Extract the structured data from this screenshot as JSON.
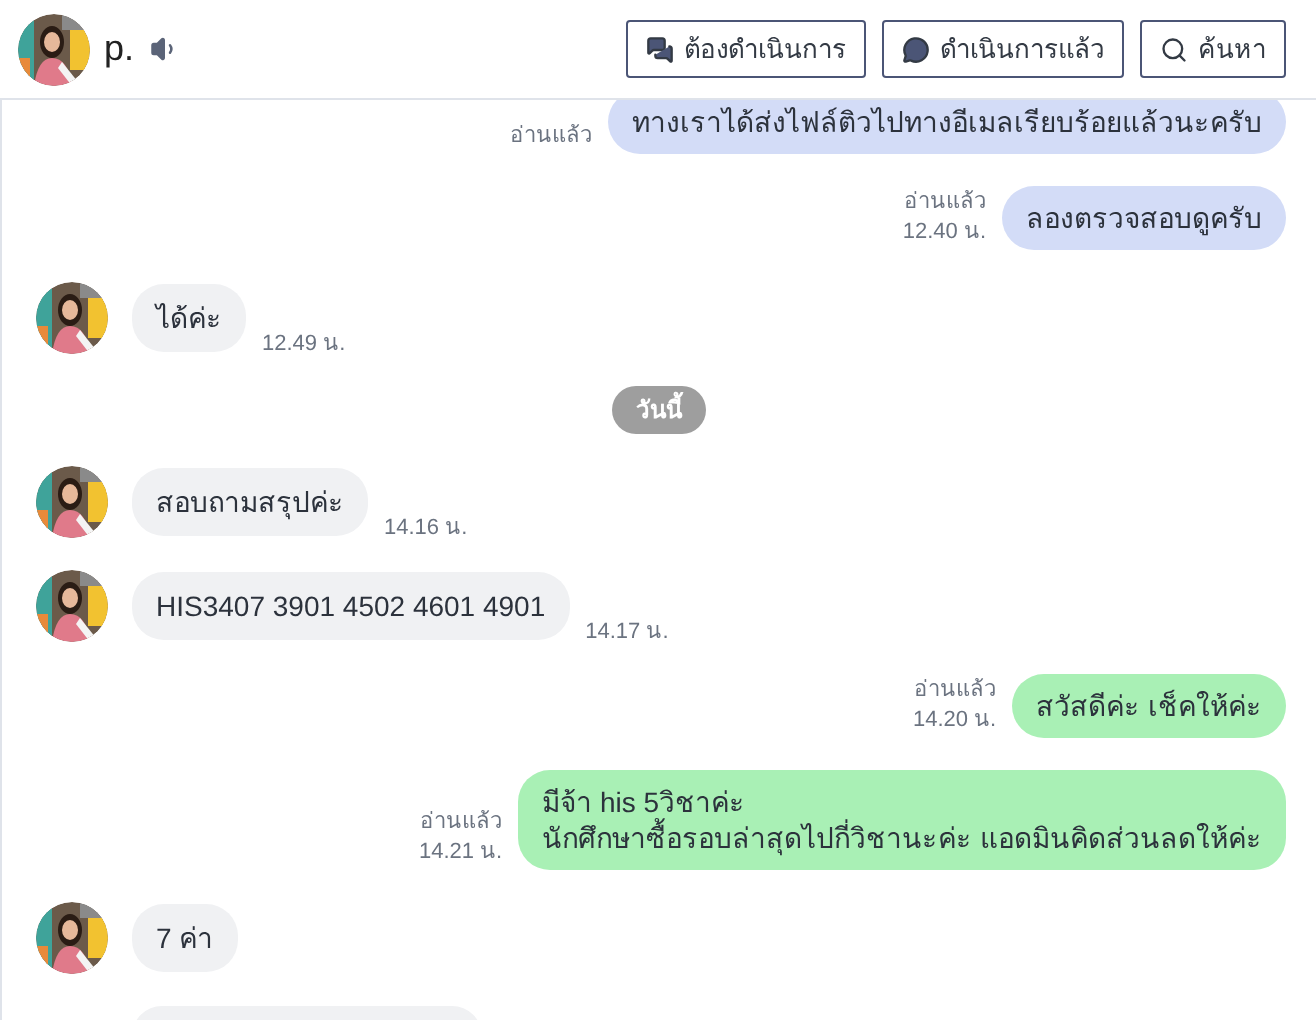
{
  "header": {
    "name": "p.",
    "buttons": [
      {
        "label": "ต้องดำเนินการ",
        "kind": "todo"
      },
      {
        "label": "ดำเนินการแล้ว",
        "kind": "done"
      },
      {
        "label": "ค้นหา",
        "kind": "search"
      }
    ]
  },
  "messages": [
    {
      "kind": "outgoing",
      "text": "ทางเราได้ส่งไฟล์ติวไปทางอีเมลเรียบร้อยแล้วนะครับ",
      "read": "อ่านแล้ว",
      "color": "#d3dcf7"
    },
    {
      "kind": "outgoing",
      "text": "ลองตรวจสอบดูครับ",
      "read": "อ่านแล้ว",
      "time": "12.40 น.",
      "color": "#d3dcf7"
    },
    {
      "kind": "incoming",
      "text": "ได้ค่ะ",
      "time": "12.49 น."
    },
    {
      "kind": "date",
      "text": "วันนี้"
    },
    {
      "kind": "incoming",
      "text": "สอบถามสรุปค่ะ",
      "time": "14.16 น."
    },
    {
      "kind": "incoming",
      "text": "HIS3407 3901 4502 4601 4901",
      "time": "14.17 น."
    },
    {
      "kind": "outgoing",
      "text": "สวัสดีค่ะ เช็คให้ค่ะ",
      "read": "อ่านแล้ว",
      "time": "14.20 น.",
      "color": "#a9f0b5"
    },
    {
      "kind": "outgoing",
      "text": "มีจ้า his 5วิชาค่ะ\nนักศึกษาซื้อรอบล่าสุดไปกี่วิชานะค่ะ แอดมินคิดส่วนลดให้ค่ะ",
      "read": "อ่านแล้ว",
      "time": "14.21 น.",
      "color": "#a9f0b5"
    },
    {
      "kind": "incoming",
      "text": "7 ค่า"
    }
  ]
}
